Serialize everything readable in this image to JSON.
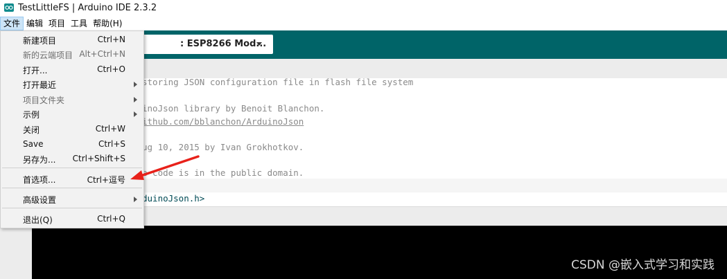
{
  "window": {
    "title": "TestLittleFS | Arduino IDE 2.3.2"
  },
  "menubar": [
    "文件",
    "编辑",
    "项目",
    "工具",
    "帮助(H)"
  ],
  "toolbar": {
    "board_label": ": ESP8266 Mod..."
  },
  "file_menu": {
    "items": [
      {
        "label": "新建项目",
        "shortcut": "Ctrl+N"
      },
      {
        "label": "新的云端项目",
        "shortcut": "Alt+Ctrl+N"
      },
      {
        "label": "打开...",
        "shortcut": "Ctrl+O"
      },
      {
        "label": "打开最近",
        "shortcut": ""
      },
      {
        "label": "项目文件夹",
        "shortcut": ""
      },
      {
        "label": "示例",
        "shortcut": ""
      },
      {
        "label": "关闭",
        "shortcut": "Ctrl+W"
      },
      {
        "label": "Save",
        "shortcut": "Ctrl+S"
      },
      {
        "label": "另存为...",
        "shortcut": "Ctrl+Shift+S"
      },
      {
        "label": "首选项...",
        "shortcut": "Ctrl+逗号"
      },
      {
        "label": "高级设置",
        "shortcut": ""
      },
      {
        "label": "退出(Q)",
        "shortcut": "Ctrl+Q"
      }
    ]
  },
  "editor": {
    "lines": [
      "storing JSON configuration file in flash file system",
      "inoJson library by Benoit Blanchon.",
      "ithub.com/bblanchon/ArduinoJson",
      "ug 10, 2015 by Ivan Grokhotkov.",
      "e code is in the public domain.",
      "duinoJson.h>"
    ]
  },
  "watermark": "CSDN @嵌入式学习和实践",
  "colors": {
    "toolbar": "#006468",
    "annotation": "#e8211a"
  }
}
